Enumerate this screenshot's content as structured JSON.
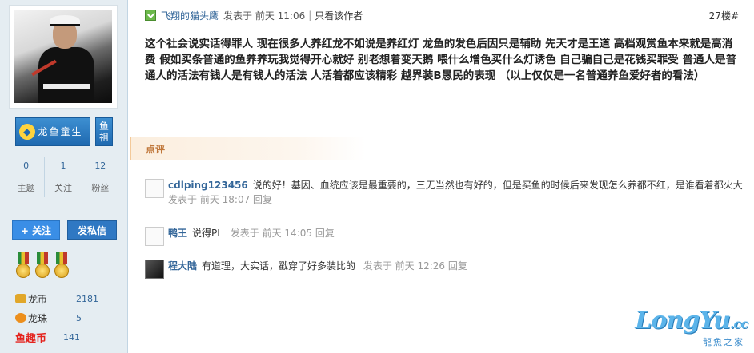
{
  "sidebar": {
    "badges": [
      {
        "icon": "dragon-icon",
        "label": "龙鱼童生"
      },
      {
        "label": "鱼祖"
      }
    ],
    "stats": [
      {
        "value": "0",
        "label": "主题"
      },
      {
        "value": "1",
        "label": "关注"
      },
      {
        "value": "12",
        "label": "粉丝"
      }
    ],
    "follow_button": "+ 关注",
    "message_button": "发私信",
    "currencies": [
      {
        "name": "龙币",
        "value": "2181"
      },
      {
        "name": "龙珠",
        "value": "5"
      },
      {
        "name": "鱼趣币",
        "value": "141"
      }
    ]
  },
  "post": {
    "author": "飞翔的猫头鹰",
    "time": "发表于 前天 11:06",
    "only_author": "只看该作者",
    "floor": "27楼#",
    "body": "这个社会说实话得罪人  现在很多人养红龙不如说是养红灯 龙鱼的发色后因只是辅助 先天才是王道 高档观赏鱼本来就是高消费 假如买条普通的鱼养养玩我觉得开心就好 别老想着变天鹅 喂什么增色买什么灯诱色 自己骗自己是花钱买罪受  普通人是普通人的活法有钱人是有钱人的活法  人活着都应该精彩 越界装B愚民的表现 （以上仅仅是一名普通养鱼爱好者的看法）"
  },
  "rate_label": "点评",
  "comments": [
    {
      "name": "cdlping123456",
      "text": "说的好！基因、血统应该是最重要的，三无当然也有好的，但是买鱼的时候后来发现怎么养都不红，是谁看着都火大",
      "time": "发表于 前天 18:07",
      "reply": "回复"
    },
    {
      "name": "鸭王",
      "text": "说得PL",
      "time": "发表于 前天 14:05",
      "reply": "回复"
    },
    {
      "name": "程大陆",
      "text": "有道理，大实话，戳穿了好多装比的",
      "time": "发表于 前天 12:26",
      "reply": "回复"
    }
  ],
  "watermark": {
    "word": "LongYu",
    "suffix": ".cc",
    "tagline": "龍魚之家"
  }
}
